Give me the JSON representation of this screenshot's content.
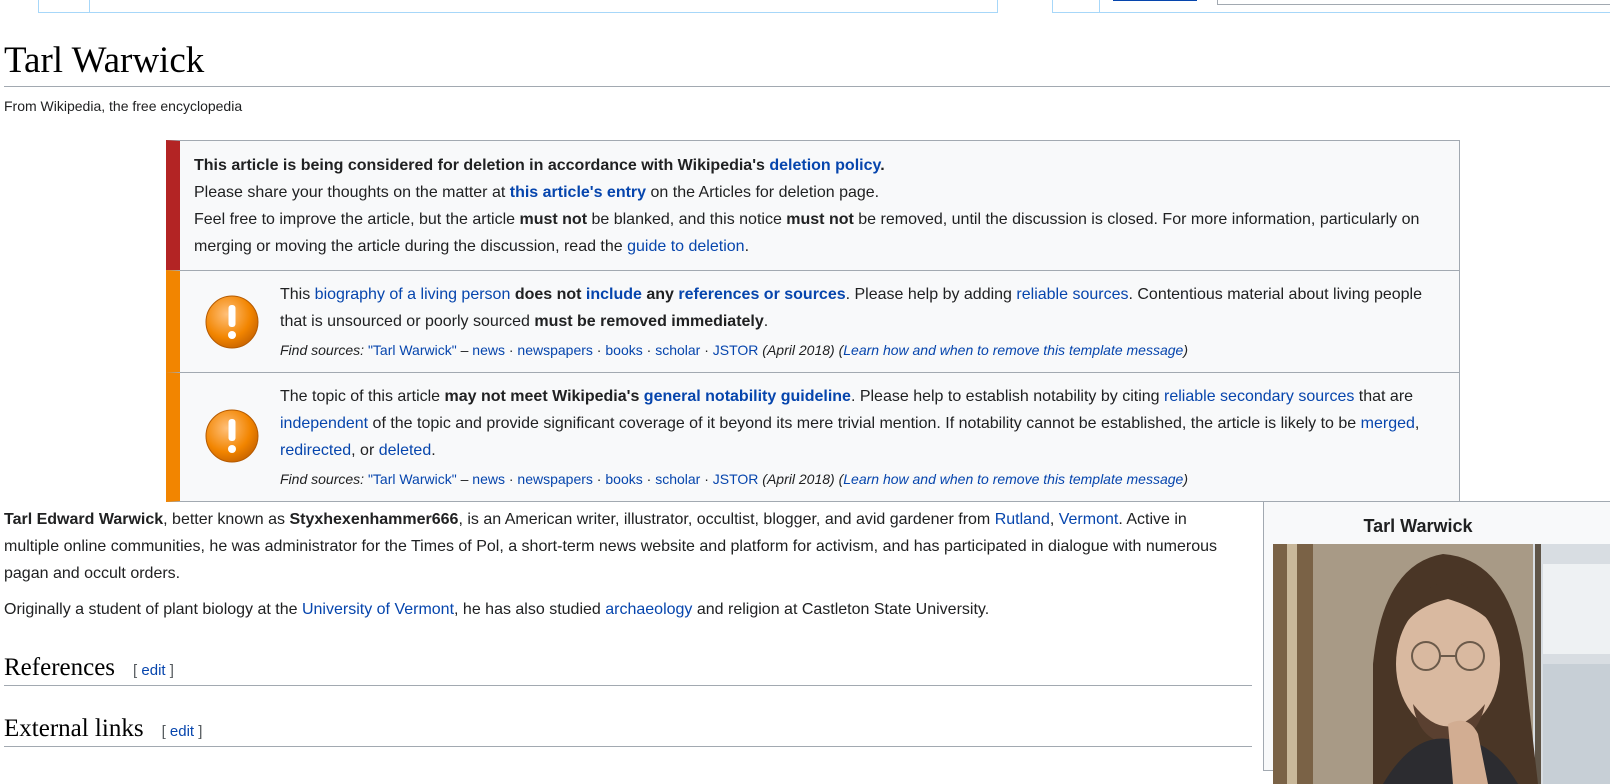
{
  "page": {
    "title": "Tarl Warwick",
    "tagline": "From Wikipedia, the free encyclopedia"
  },
  "afd_notice": {
    "lead_bold": "This article is being considered for deletion in accordance with Wikipedia's ",
    "lead_link": "deletion policy",
    "lead_end": ".",
    "line2_pre": "Please share your thoughts on the matter at ",
    "line2_link": "this article's entry",
    "line2_post": " on the Articles for deletion page.",
    "line3_a": "Feel free to improve the article, but the article ",
    "line3_b": "must not",
    "line3_c": " be blanked, and this notice ",
    "line3_d": "must not",
    "line3_e": " be removed, until the discussion is closed. For more information, particularly on merging or moving the article during the discussion, read the ",
    "line3_link": "guide to deletion",
    "line3_end": "."
  },
  "blp_notice": {
    "t1": "This ",
    "l1": "biography of a living person",
    "t2": " ",
    "b1": "does not ",
    "l2": "include",
    "b2": " any ",
    "l3": "references or sources",
    "t3": ". Please help by adding ",
    "l4": "reliable sources",
    "t4": ". Contentious material about living people that is unsourced or poorly sourced ",
    "b3": "must be removed immediately",
    "t5": "."
  },
  "notability_notice": {
    "t1": "The topic of this article ",
    "b1": "may not meet Wikipedia's ",
    "l1": "general notability guideline",
    "t2": ". Please help to establish notability by citing ",
    "l2": "reliable secondary sources",
    "t3": " that are ",
    "l3": "independent",
    "t4": " of the topic and provide significant coverage of it beyond its mere trivial mention. If notability cannot be established, the article is likely to be ",
    "l4": "merged",
    "t5": ", ",
    "l5": "redirected",
    "t6": ", or ",
    "l6": "deleted",
    "t7": "."
  },
  "find_sources": {
    "label": "Find sources: ",
    "query": "\"Tarl Warwick\"",
    "dash": " – ",
    "news": "news",
    "sep": " · ",
    "newspapers": "newspapers",
    "books": "books",
    "scholar": "scholar",
    "jstor": "JSTOR",
    "date": " (April 2018) ",
    "paren_open": "(",
    "learn": "Learn how and when to remove this template message",
    "paren_close": ")"
  },
  "article": {
    "p1_b1": "Tarl Edward Warwick",
    "p1_t1": ", better known as ",
    "p1_b2": "Styxhexenhammer666",
    "p1_t2": ", is an American writer, illustrator, occultist, blogger, and avid gardener from ",
    "p1_l1": "Rutland",
    "p1_t3": ", ",
    "p1_l2": "Vermont",
    "p1_t4": ". Active in multiple online communities, he was administrator for the Times of Pol, a short-term news website and platform for activism, and has participated in dialogue with numerous pagan and occult orders.",
    "p2_t1": "Originally a student of plant biology at the ",
    "p2_l1": "University of Vermont",
    "p2_t2": ", he has also studied ",
    "p2_l2": "archaeology",
    "p2_t3": " and religion at Castleton State University."
  },
  "sections": {
    "references": "References",
    "external_links": "External links",
    "edit_open": "[ ",
    "edit": "edit",
    "edit_close": " ]"
  },
  "infobox": {
    "title": "Tarl Warwick"
  },
  "colors": {
    "link": "#0645ad",
    "delete_bar": "#b32424",
    "content_bar": "#f28500",
    "warning_icon": "#f28500"
  }
}
